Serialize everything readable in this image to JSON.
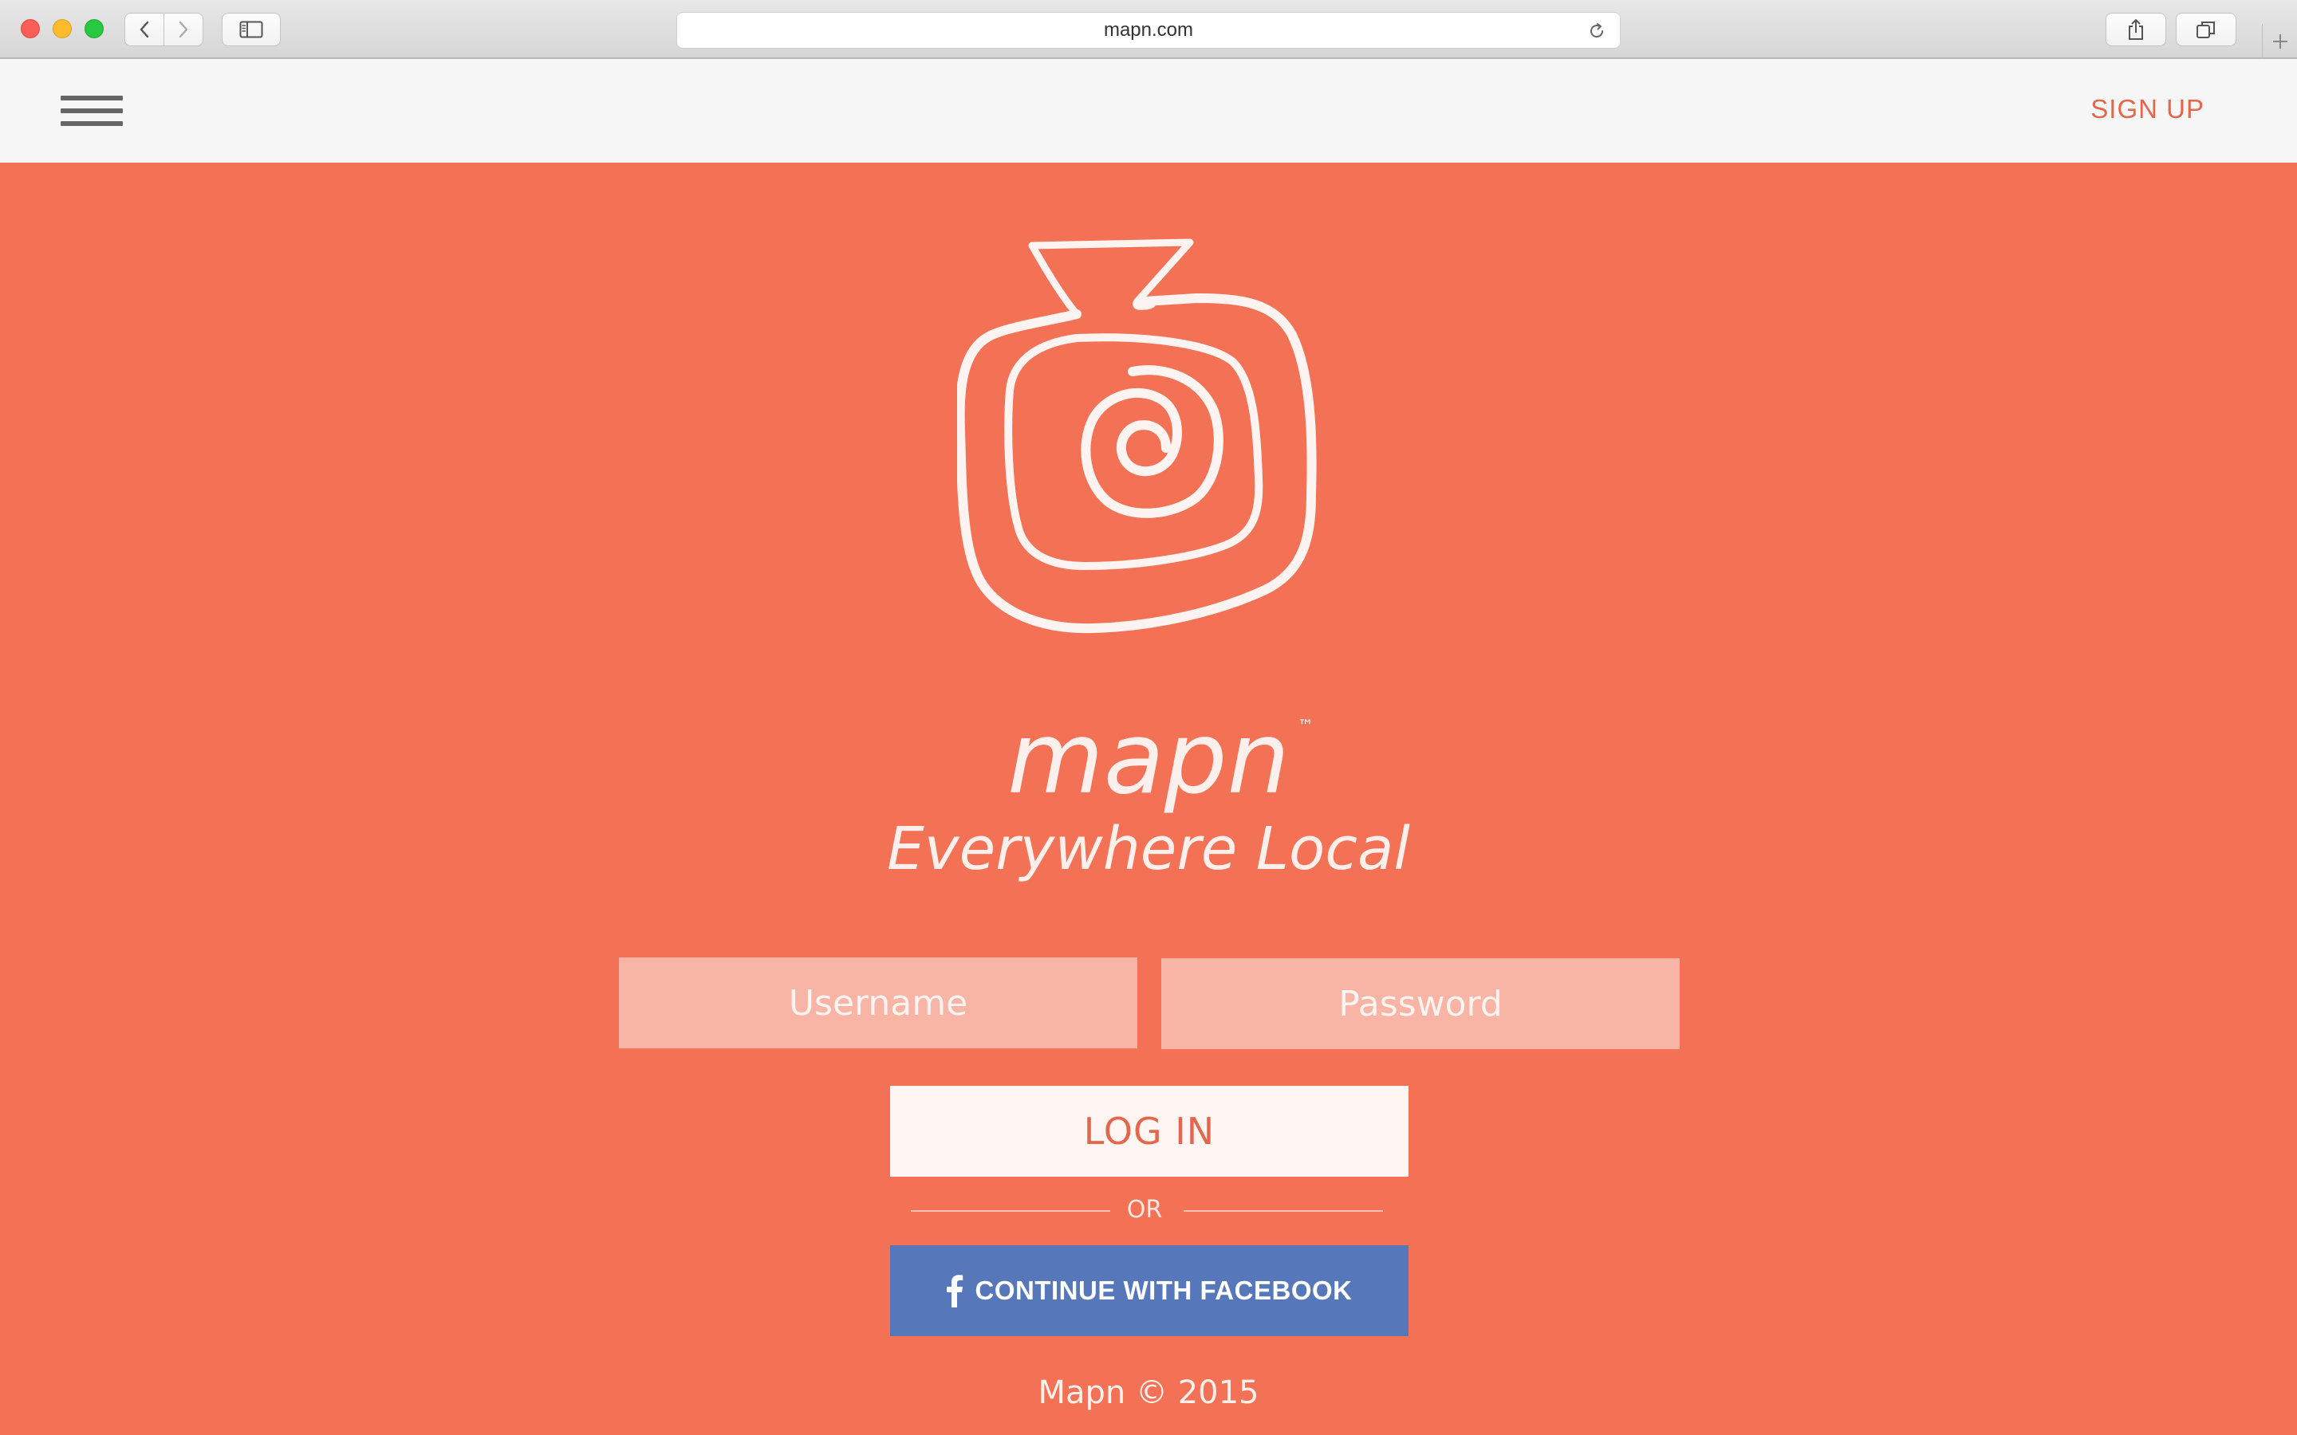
{
  "browser": {
    "url": "mapn.com"
  },
  "header": {
    "menu_icon": "hamburger-icon",
    "signup_label": "SIGN UP"
  },
  "hero": {
    "logo_icon": "mapn-bag-logo",
    "wordmark": "mapn",
    "trademark": "™",
    "tagline": "Everywhere Local"
  },
  "login_form": {
    "username_placeholder": "Username",
    "password_placeholder": "Password",
    "login_label": "LOG IN",
    "divider_text": "OR",
    "facebook_label": "CONTINUE WITH FACEBOOK",
    "facebook_icon": "facebook-icon"
  },
  "footer": {
    "copyright": "Mapn © 2015"
  },
  "colors": {
    "background": "#f37255",
    "header_bg": "#f6f6f6",
    "accent": "#e3674d",
    "input_bg": "#f8b5a5",
    "facebook": "#5677ba"
  }
}
